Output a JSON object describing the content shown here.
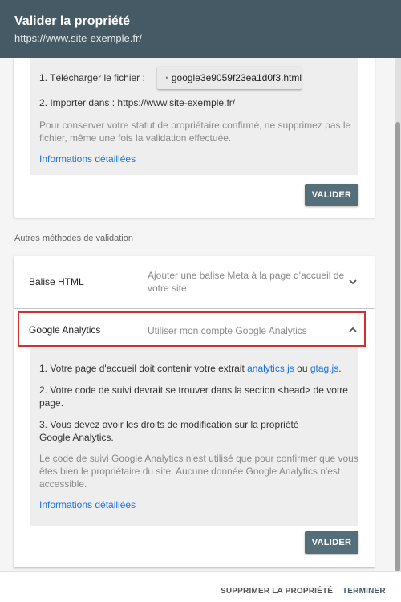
{
  "dialog": {
    "title": "Valider la propriété",
    "url": "https://www.site-exemple.fr/"
  },
  "html_file_method": {
    "step1_label": "1. Télécharger le fichier :",
    "download_filename": "google3e9059f23ea1d0f3.html",
    "step2_prefix": "2. Importer dans :",
    "step2_url": "https://www.site-exemple.fr/",
    "note_line1": "Pour conserver votre statut de propriétaire confirmé, ne supprimez pas le",
    "note_line2": "fichier, même une fois la validation effectuée.",
    "details_link": "Informations détaillées",
    "verify_button": "VALIDER"
  },
  "other_methods": {
    "section_label": "Autres méthodes de validation",
    "html_tag": {
      "name": "Balise HTML",
      "desc_line1": "Ajouter une balise Meta à la page d'accueil de",
      "desc_line2": "votre site"
    },
    "google_analytics": {
      "name": "Google Analytics",
      "desc": "Utiliser mon compte Google Analytics",
      "step1_prefix": "1. Votre page d'accueil doit contenir votre extrait",
      "step1_link1": "analytics.js",
      "step1_or": "ou",
      "step1_link2": "gtag.js",
      "step1_end": ".",
      "step2_line1": "2. Votre code de suivi devrait se trouver dans la section <head> de votre",
      "step2_line2": "page.",
      "step3_line1": "3. Vous devez avoir les droits de modification sur la propriété",
      "step3_line2": "Google Analytics.",
      "note_line1": "Le code de suivi Google Analytics n'est utilisé que pour confirmer que vous",
      "note_line2": "êtes bien le propriétaire du site. Aucune donnée Google Analytics n'est",
      "note_line3": "accessible.",
      "details_link": "Informations détaillées",
      "verify_button": "VALIDER"
    }
  },
  "footer": {
    "remove_property": "SUPPRIMER LA PROPRIÉTÉ",
    "done": "TERMINER"
  },
  "colors": {
    "header_bg": "#455a64",
    "button_bg": "#546e7a",
    "link": "#1a73e8",
    "highlight": "#d32f2f"
  },
  "icons": [
    "download-icon",
    "chevron-down-icon",
    "chevron-up-icon"
  ]
}
